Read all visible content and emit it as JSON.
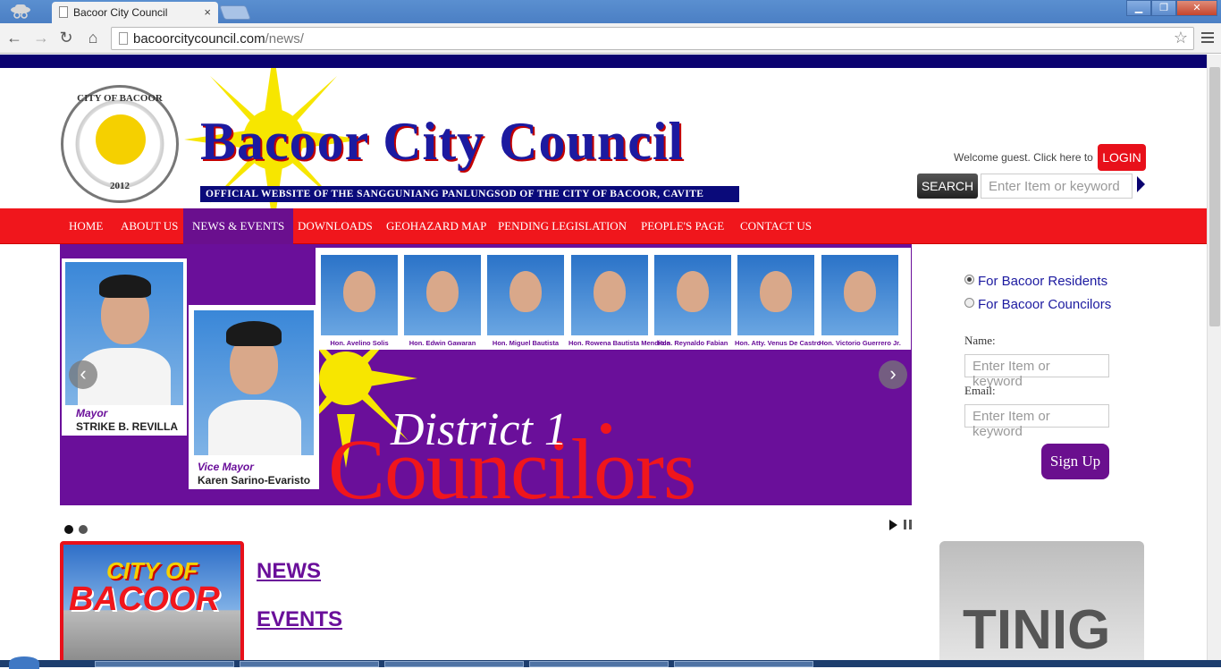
{
  "browser": {
    "tab_title": "Bacoor City Council",
    "tab_close": "×",
    "url_domain": "bacoorcitycouncil.com",
    "url_path": "/news/",
    "window_buttons": [
      "▁",
      "❐",
      "✕"
    ]
  },
  "header": {
    "seal_top": "CITY OF BACOOR",
    "seal_year": "2012",
    "site_title": "Bacoor City Council",
    "site_subtitle": "OFFICIAL WEBSITE OF THE SANGGUNIANG PANLUNGSOD OF THE CITY OF BACOOR, CAVITE",
    "welcome": "Welcome guest. Click here to",
    "login": "LOGIN",
    "search_button": "SEARCH",
    "search_placeholder": "Enter Item or keyword"
  },
  "nav": {
    "items": [
      "HOME",
      "ABOUT US",
      "NEWS & EVENTS",
      "DOWNLOADS",
      "GEOHAZARD MAP",
      "PENDING LEGISLATION",
      "PEOPLE'S PAGE",
      "CONTACT US"
    ],
    "active": "NEWS & EVENTS"
  },
  "slider": {
    "mayor_role": "Mayor",
    "mayor_name": "STRIKE B. REVILLA",
    "vice_role": "Vice Mayor",
    "vice_name": "Karen Sarino-Evaristo",
    "councilors": [
      "Hon. Avelino Solis",
      "Hon. Edwin Gawaran",
      "Hon. Miguel Bautista",
      "Hon. Rowena Bautista Mendiola",
      "Hon. Reynaldo Fabian",
      "Hon. Atty. Venus De Castro",
      "Hon. Victorio Guerrero Jr."
    ],
    "headline_1": "District 1",
    "headline_2": "Councilors",
    "prev": "‹",
    "next": "›",
    "slide_count": 2,
    "current_slide": 1
  },
  "signup": {
    "option_residents": "For Bacoor Residents",
    "option_councilors": "For Bacoor Councilors",
    "selected": "For Bacoor Residents",
    "name_label": "Name:",
    "name_placeholder": "Enter Item or keyword",
    "email_label": "Email:",
    "email_placeholder": "Enter Item or keyword",
    "submit": "Sign Up"
  },
  "content": {
    "city_card_line1": "CITY OF",
    "city_card_line2": "BACOOR",
    "news_link": "NEWS",
    "events_link": "EVENTS",
    "tinig": "TINIG"
  },
  "colors": {
    "brand_red": "#f0161c",
    "brand_purple": "#6a0f9a",
    "brand_navy": "#0a0270"
  }
}
